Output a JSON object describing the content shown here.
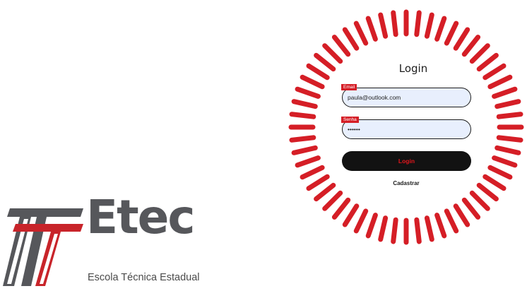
{
  "logo": {
    "wordmark": "Etec",
    "subtitle": "Escola Técnica Estadual",
    "colors": {
      "gray": "#56575b",
      "red": "#c8242a"
    }
  },
  "login": {
    "title": "Login",
    "email": {
      "label": "Email",
      "value": "paula@outlook.com"
    },
    "senha": {
      "label": "Senha",
      "value": "••••••"
    },
    "button_label": "Login",
    "register_label": "Cadastrar",
    "colors": {
      "accent": "#d51e26",
      "field_background": "#e8effd",
      "button_background": "#121212",
      "button_text": "#e0161c"
    }
  }
}
